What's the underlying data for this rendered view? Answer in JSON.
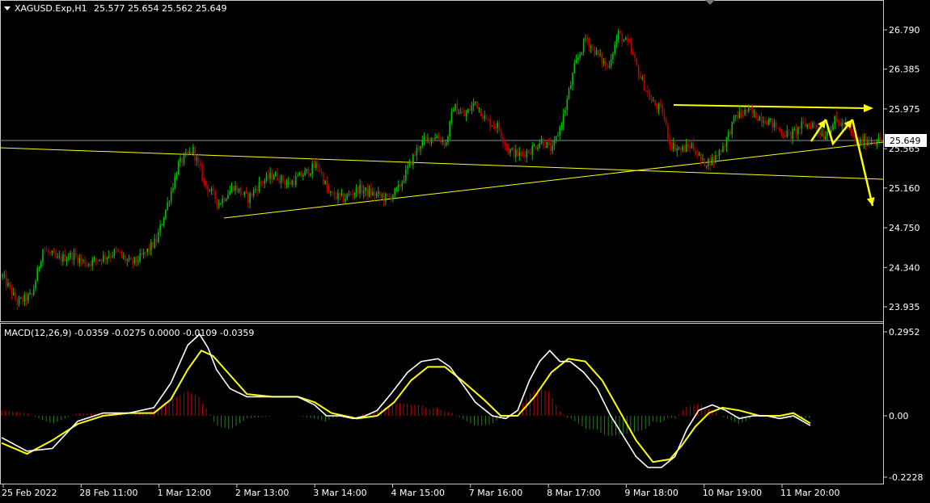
{
  "header": {
    "symbol": "XAGUSD.Exp,H1",
    "ohlc": "25.577 25.654 25.562 25.649"
  },
  "indicator": {
    "label": "MACD(12,26,9) -0.0359 -0.0275 0.0000 -0.0109 -0.0359"
  },
  "colors": {
    "background": "#000000",
    "bull": "#00c000",
    "bear": "#c00000",
    "trendline": "#ffff00",
    "macd_line": "#ffffff",
    "signal_line": "#ffff00",
    "hist_pos": "#c00000",
    "hist_neg": "#1f7f1f",
    "price_line": "#7f8fa0"
  },
  "chart_data": [
    {
      "type": "candlestick",
      "title": "XAGUSD.Exp,H1",
      "price_ticks": [
        "26.790",
        "26.385",
        "25.975",
        "25.565",
        "25.160",
        "24.750",
        "24.340",
        "23.935"
      ],
      "current_price": "25.649",
      "ylim": [
        23.81,
        27.01
      ],
      "x_labels": [
        "25 Feb 2022",
        "28 Feb 11:00",
        "1 Mar 12:00",
        "2 Mar 13:00",
        "3 Mar 14:00",
        "4 Mar 15:00",
        "7 Mar 16:00",
        "8 Mar 17:00",
        "9 Mar 18:00",
        "10 Mar 19:00",
        "11 Mar 20:00"
      ],
      "close_path": [
        [
          0,
          24.25
        ],
        [
          8,
          23.98
        ],
        [
          16,
          24.05
        ],
        [
          22,
          24.53
        ],
        [
          30,
          24.42
        ],
        [
          38,
          24.47
        ],
        [
          46,
          24.38
        ],
        [
          54,
          24.44
        ],
        [
          62,
          24.5
        ],
        [
          70,
          24.38
        ],
        [
          76,
          24.45
        ],
        [
          84,
          24.62
        ],
        [
          90,
          25.0
        ],
        [
          96,
          25.4
        ],
        [
          100,
          25.48
        ],
        [
          104,
          25.55
        ],
        [
          110,
          25.22
        ],
        [
          118,
          25.0
        ],
        [
          126,
          25.18
        ],
        [
          134,
          25.05
        ],
        [
          140,
          25.2
        ],
        [
          148,
          25.3
        ],
        [
          156,
          25.2
        ],
        [
          164,
          25.3
        ],
        [
          172,
          25.4
        ],
        [
          178,
          25.1
        ],
        [
          186,
          25.05
        ],
        [
          194,
          25.15
        ],
        [
          202,
          25.1
        ],
        [
          210,
          25.05
        ],
        [
          216,
          25.15
        ],
        [
          222,
          25.4
        ],
        [
          228,
          25.62
        ],
        [
          236,
          25.7
        ],
        [
          242,
          25.62
        ],
        [
          246,
          26.0
        ],
        [
          252,
          25.9
        ],
        [
          258,
          26.05
        ],
        [
          264,
          25.85
        ],
        [
          270,
          25.8
        ],
        [
          276,
          25.55
        ],
        [
          282,
          25.5
        ],
        [
          288,
          25.55
        ],
        [
          294,
          25.65
        ],
        [
          300,
          25.55
        ],
        [
          306,
          25.9
        ],
        [
          312,
          26.4
        ],
        [
          318,
          26.7
        ],
        [
          324,
          26.55
        ],
        [
          330,
          26.4
        ],
        [
          336,
          26.75
        ],
        [
          342,
          26.62
        ],
        [
          348,
          26.3
        ],
        [
          354,
          26.05
        ],
        [
          360,
          25.95
        ],
        [
          364,
          25.62
        ],
        [
          370,
          25.55
        ],
        [
          376,
          25.6
        ],
        [
          382,
          25.42
        ],
        [
          388,
          25.45
        ],
        [
          394,
          25.62
        ],
        [
          400,
          25.9
        ],
        [
          406,
          25.95
        ],
        [
          412,
          25.9
        ],
        [
          418,
          25.85
        ],
        [
          424,
          25.75
        ],
        [
          430,
          25.7
        ],
        [
          436,
          25.8
        ],
        [
          442,
          25.82
        ],
        [
          448,
          25.7
        ],
        [
          454,
          25.85
        ],
        [
          460,
          25.8
        ],
        [
          466,
          25.62
        ],
        [
          472,
          25.65
        ],
        [
          478,
          25.649
        ]
      ],
      "projection_arrows": [
        [
          [
            1003,
            175
          ],
          [
            1021,
            148
          ]
        ],
        [
          [
            1021,
            148
          ],
          [
            1030,
            178
          ],
          [
            1054,
            148
          ]
        ],
        [
          [
            1054,
            148
          ],
          [
            1079,
            255
          ]
        ]
      ]
    },
    {
      "type": "macd",
      "title": "MACD(12,26,9)",
      "ticks": [
        "0.2952",
        "0.00",
        "-0.2228"
      ],
      "ylim": [
        -0.2228,
        0.2952
      ],
      "macd": [
        [
          0,
          -0.08
        ],
        [
          15,
          -0.13
        ],
        [
          30,
          -0.12
        ],
        [
          45,
          -0.02
        ],
        [
          60,
          0.01
        ],
        [
          75,
          0.01
        ],
        [
          90,
          0.03
        ],
        [
          100,
          0.12
        ],
        [
          110,
          0.26
        ],
        [
          117,
          0.3
        ],
        [
          122,
          0.25
        ],
        [
          127,
          0.17
        ],
        [
          135,
          0.1
        ],
        [
          145,
          0.07
        ],
        [
          160,
          0.07
        ],
        [
          175,
          0.07
        ],
        [
          185,
          0.04
        ],
        [
          192,
          0.0
        ],
        [
          200,
          0.0
        ],
        [
          208,
          -0.01
        ],
        [
          215,
          0.0
        ],
        [
          222,
          0.02
        ],
        [
          230,
          0.08
        ],
        [
          240,
          0.16
        ],
        [
          248,
          0.2
        ],
        [
          258,
          0.21
        ],
        [
          265,
          0.18
        ],
        [
          272,
          0.12
        ],
        [
          280,
          0.05
        ],
        [
          290,
          0.0
        ],
        [
          298,
          -0.01
        ],
        [
          305,
          0.02
        ],
        [
          312,
          0.13
        ],
        [
          318,
          0.2
        ],
        [
          324,
          0.24
        ],
        [
          330,
          0.2
        ],
        [
          336,
          0.2
        ],
        [
          344,
          0.16
        ],
        [
          352,
          0.1
        ],
        [
          360,
          0.0
        ],
        [
          368,
          -0.08
        ],
        [
          375,
          -0.15
        ],
        [
          382,
          -0.19
        ],
        [
          390,
          -0.19
        ],
        [
          398,
          -0.15
        ],
        [
          405,
          -0.05
        ],
        [
          412,
          0.02
        ],
        [
          420,
          0.04
        ],
        [
          428,
          0.02
        ],
        [
          436,
          -0.01
        ],
        [
          444,
          0.0
        ],
        [
          452,
          0.0
        ],
        [
          460,
          -0.01
        ],
        [
          468,
          0.0
        ],
        [
          478,
          -0.0359
        ]
      ],
      "signal": [
        [
          0,
          -0.1
        ],
        [
          15,
          -0.14
        ],
        [
          30,
          -0.09
        ],
        [
          45,
          -0.03
        ],
        [
          60,
          0.0
        ],
        [
          75,
          0.01
        ],
        [
          90,
          0.01
        ],
        [
          100,
          0.06
        ],
        [
          110,
          0.17
        ],
        [
          118,
          0.24
        ],
        [
          125,
          0.22
        ],
        [
          135,
          0.15
        ],
        [
          145,
          0.08
        ],
        [
          160,
          0.07
        ],
        [
          175,
          0.07
        ],
        [
          185,
          0.05
        ],
        [
          195,
          0.01
        ],
        [
          210,
          -0.01
        ],
        [
          222,
          0.0
        ],
        [
          232,
          0.05
        ],
        [
          242,
          0.13
        ],
        [
          252,
          0.18
        ],
        [
          262,
          0.18
        ],
        [
          272,
          0.13
        ],
        [
          285,
          0.06
        ],
        [
          295,
          0.0
        ],
        [
          305,
          0.0
        ],
        [
          315,
          0.07
        ],
        [
          325,
          0.16
        ],
        [
          335,
          0.21
        ],
        [
          345,
          0.2
        ],
        [
          355,
          0.13
        ],
        [
          365,
          0.02
        ],
        [
          375,
          -0.09
        ],
        [
          385,
          -0.17
        ],
        [
          395,
          -0.16
        ],
        [
          402,
          -0.11
        ],
        [
          410,
          -0.04
        ],
        [
          418,
          0.01
        ],
        [
          426,
          0.03
        ],
        [
          436,
          0.02
        ],
        [
          448,
          0.0
        ],
        [
          460,
          0.0
        ],
        [
          468,
          0.01
        ],
        [
          478,
          -0.0275
        ]
      ]
    }
  ]
}
